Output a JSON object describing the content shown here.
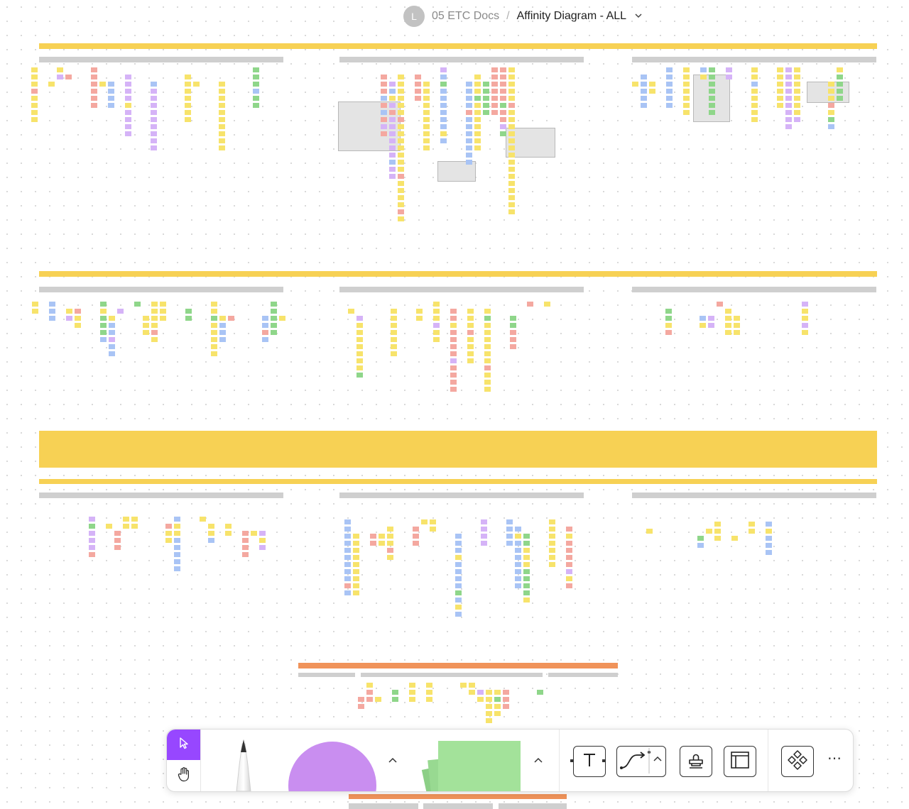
{
  "breadcrumb": {
    "avatar_initial": "L",
    "parent": "05 ETC Docs",
    "separator": "/",
    "title": "Affinity Diagram - ALL",
    "chevron_icon": "chevron-down-icon"
  },
  "colors": {
    "header_band": "#f7d154",
    "sticky_yellow": "#f7e36b",
    "sticky_pink": "#f4a8a0",
    "sticky_blue": "#a9c4f5",
    "sticky_green": "#8fd68a",
    "sticky_purple": "#d5b3f7",
    "orange_band": "#f0935a",
    "accent_purple": "#9747ff",
    "circle_tool": "#c98ef0",
    "sticky_tool": "#a3e29a"
  },
  "toolbar": {
    "move_tool_icon": "cursor-arrow-icon",
    "hand_tool_icon": "hand-icon",
    "pencil_icon": "pencil-icon",
    "shape_icon": "circle-shape-icon",
    "shape_caret_icon": "chevron-up-icon",
    "sticky_icon": "sticky-note-icon",
    "sticky_caret_icon": "chevron-up-icon",
    "text_icon": "text-tool-icon",
    "connector_icon": "connector-icon",
    "connector_caret_icon": "chevron-up-icon",
    "stamp_icon": "stamp-icon",
    "section_icon": "section-icon",
    "widgets_icon": "widgets-icon",
    "more_label": "⋯"
  }
}
